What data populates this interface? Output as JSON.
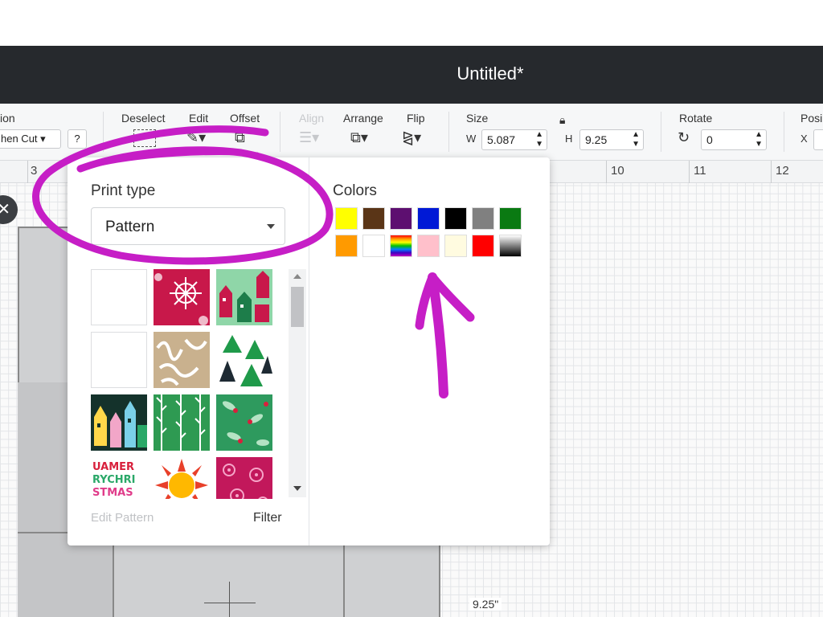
{
  "window": {
    "title": "Untitled*"
  },
  "toolbar": {
    "operation_label": "ion",
    "operation_value": "hen Cut",
    "help_label": "?",
    "deselect_label": "Deselect",
    "edit_label": "Edit",
    "offset_label": "Offset",
    "align_label": "Align",
    "arrange_label": "Arrange",
    "flip_label": "Flip",
    "size_label": "Size",
    "w_label": "W",
    "w_value": "5.087",
    "h_label": "H",
    "h_value": "9.25",
    "rotate_label": "Rotate",
    "rotate_value": "0",
    "position_label": "Posi",
    "x_label": "X"
  },
  "ruler": {
    "ticks": [
      "3",
      "10",
      "11",
      "12"
    ]
  },
  "canvas": {
    "dimension_label": "9.25\""
  },
  "panel": {
    "print_type_label": "Print type",
    "print_type_value": "Pattern",
    "colors_label": "Colors",
    "edit_pattern_label": "Edit Pattern",
    "filter_label": "Filter",
    "swatches": [
      "#ffff00",
      "#5a3517",
      "#5d0f70",
      "#0019d6",
      "#000000",
      "#808080",
      "#0a7a12",
      "#ff9a00",
      "#ffffff",
      "rainbow",
      "#ffc0cb",
      "#fffbe0",
      "#ff0000",
      "gradient-black-white"
    ],
    "patterns": [
      "blank",
      "red-snowflake",
      "green-houses",
      "blank",
      "tan-script",
      "green-trees",
      "dark-houses",
      "green-leaves",
      "green-holly",
      "merry-christmas-letters",
      "orange-sun",
      "pink-floral"
    ]
  },
  "annotation_color": "#c61ec6"
}
